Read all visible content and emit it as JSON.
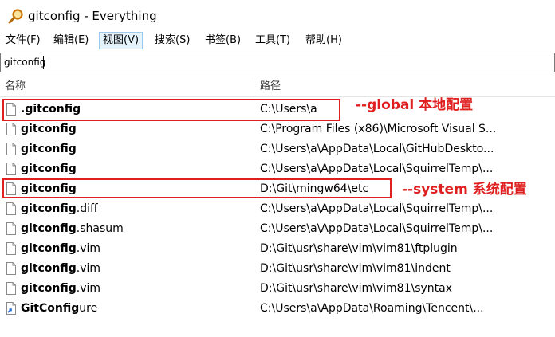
{
  "window": {
    "title": "gitconfig - Everything",
    "app_icon": "magnifier-icon"
  },
  "menu": [
    {
      "label": "文件(F)"
    },
    {
      "label": "编辑(E)"
    },
    {
      "label": "视图(V)"
    },
    {
      "label": "搜索(S)"
    },
    {
      "label": "书签(B)"
    },
    {
      "label": "工具(T)"
    },
    {
      "label": "帮助(H)"
    }
  ],
  "search": {
    "value": "gitconfig"
  },
  "columns": {
    "name": "名称",
    "path": "路径"
  },
  "rows": [
    {
      "name_bold": ".gitconfig",
      "name_rest": "",
      "path": "C:\\Users\\a",
      "icon": "file-icon"
    },
    {
      "name_bold": "gitconfig",
      "name_rest": "",
      "path": "C:\\Program Files (x86)\\Microsoft Visual S...",
      "icon": "file-icon"
    },
    {
      "name_bold": "gitconfig",
      "name_rest": "",
      "path": "C:\\Users\\a\\AppData\\Local\\GitHubDeskto...",
      "icon": "file-icon"
    },
    {
      "name_bold": "gitconfig",
      "name_rest": "",
      "path": "C:\\Users\\a\\AppData\\Local\\SquirrelTemp\\...",
      "icon": "file-icon"
    },
    {
      "name_bold": "gitconfig",
      "name_rest": "",
      "path": "D:\\Git\\mingw64\\etc",
      "icon": "file-icon"
    },
    {
      "name_bold": "gitconfig",
      "name_rest": ".diff",
      "path": "C:\\Users\\a\\AppData\\Local\\SquirrelTemp\\...",
      "icon": "file-icon"
    },
    {
      "name_bold": "gitconfig",
      "name_rest": ".shasum",
      "path": "C:\\Users\\a\\AppData\\Local\\SquirrelTemp\\...",
      "icon": "file-icon"
    },
    {
      "name_bold": "gitconfig",
      "name_rest": ".vim",
      "path": "D:\\Git\\usr\\share\\vim\\vim81\\ftplugin",
      "icon": "file-icon"
    },
    {
      "name_bold": "gitconfig",
      "name_rest": ".vim",
      "path": "D:\\Git\\usr\\share\\vim\\vim81\\indent",
      "icon": "file-icon"
    },
    {
      "name_bold": "gitconfig",
      "name_rest": ".vim",
      "path": "D:\\Git\\usr\\share\\vim\\vim81\\syntax",
      "icon": "file-icon"
    },
    {
      "name_bold": "GitConfig",
      "name_rest": "ure",
      "path": "C:\\Users\\a\\AppData\\Roaming\\Tencent\\...",
      "icon": "shortcut-file-icon"
    }
  ],
  "annotations": {
    "global": "--global 本地配置",
    "system": "--system 系统配置",
    "color": "#e02020"
  }
}
